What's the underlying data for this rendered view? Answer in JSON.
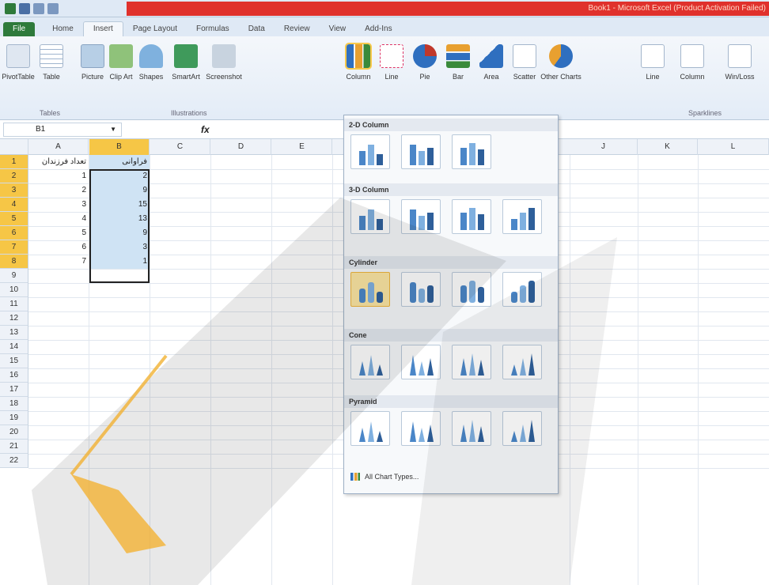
{
  "titlebar": {
    "title": "Book1 - Microsoft Excel (Product Activation Failed)"
  },
  "tabs": [
    "File",
    "Home",
    "Insert",
    "Page Layout",
    "Formulas",
    "Data",
    "Review",
    "View",
    "Add-Ins"
  ],
  "ribbon": {
    "buttons": [
      "PivotTable",
      "Table",
      "Picture",
      "Clip Art",
      "Shapes",
      "SmartArt",
      "Screenshot",
      "Column",
      "Line",
      "Pie",
      "Bar",
      "Area",
      "Scatter",
      "Other Charts",
      "Line",
      "Column",
      "Win/Loss"
    ],
    "groups": [
      "Tables",
      "Illustrations",
      "Sparklines"
    ]
  },
  "formula_bar": {
    "name_box": "B1",
    "fx": "fx"
  },
  "columns": [
    "A",
    "B",
    "C",
    "D",
    "E",
    "J",
    "K",
    "L"
  ],
  "rows": [
    "1",
    "2",
    "3",
    "4",
    "5",
    "6",
    "7",
    "8",
    "9",
    "10",
    "11",
    "12",
    "13",
    "14",
    "15",
    "16",
    "17",
    "18",
    "19",
    "20",
    "21",
    "22"
  ],
  "cells": {
    "A": [
      "تعداد فرزندان",
      "1",
      "2",
      "3",
      "4",
      "5",
      "6",
      "7"
    ],
    "B": [
      "فراوانی",
      "2",
      "9",
      "15",
      "13",
      "9",
      "3",
      "1"
    ]
  },
  "dropdown": {
    "sections": [
      "2-D Column",
      "3-D Column",
      "Cylinder",
      "Cone",
      "Pyramid"
    ],
    "footer": "All Chart Types..."
  },
  "colors": {
    "accent": "#f6c646",
    "title_red": "#e0312c",
    "file_tab": "#2e7a3b",
    "selection": "#cfe3f4"
  }
}
